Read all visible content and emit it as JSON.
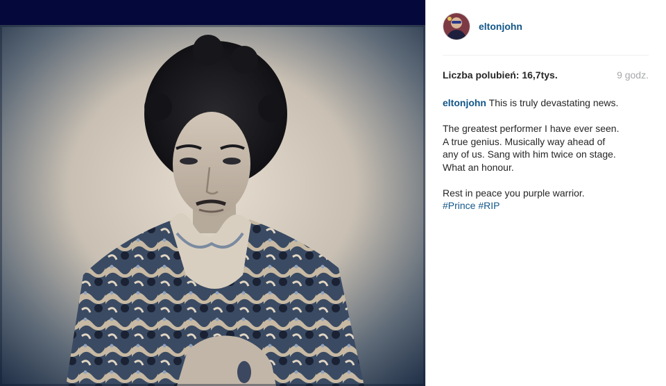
{
  "post": {
    "username": "eltonjohn",
    "likes_text": "Liczba polubień: 16,7tys.",
    "time_ago": "9 godz.",
    "caption": {
      "first_line": "This is truly devastating news.",
      "lines_para2": [
        "The greatest performer I have ever seen.",
        "A true genius. Musically way ahead of",
        "any of us. Sang with him twice on stage.",
        "What an honour."
      ],
      "para3_line": "Rest in peace you purple warrior.",
      "hashtags": [
        "#Prince",
        "#RIP"
      ]
    }
  },
  "icons": {
    "avatar": "profile-avatar",
    "photo": "portrait-photo"
  },
  "colors": {
    "link": "#125688",
    "text": "#262626",
    "muted": "#a5a7aa",
    "photo_band": "#05083a"
  }
}
